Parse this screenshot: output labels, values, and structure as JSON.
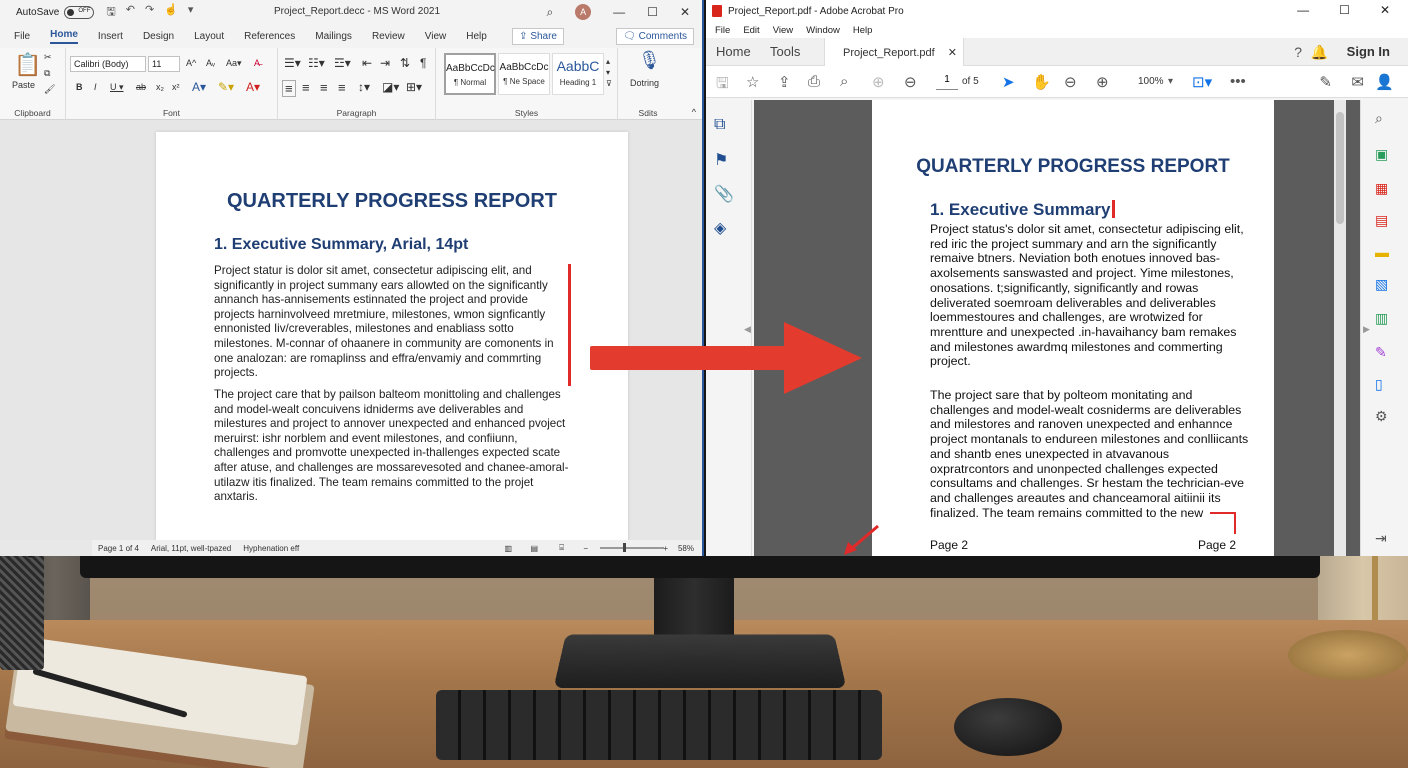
{
  "word": {
    "autosave_label": "AutoSave",
    "autosave_state": "OFF",
    "doc_title": "Project_Report.decc  -  MS Word 2021",
    "avatar_initial": "A",
    "menu": [
      "File",
      "Home",
      "Insert",
      "Design",
      "Layout",
      "References",
      "Mailings",
      "Review",
      "View",
      "Help"
    ],
    "active_menu": "Home",
    "share_label": "Share",
    "comments_label": "Comments",
    "paste_label": "Paste",
    "font_name": "Calibri (Body)",
    "font_size": "11",
    "groups": {
      "clipboard": "Clipboard",
      "font": "Font",
      "paragraph": "Paragraph",
      "styles": "Styles",
      "editing": "Sdits"
    },
    "styles": [
      {
        "sample": "AaBbCcDc",
        "name": "¶ Normal"
      },
      {
        "sample": "AaBbCcDc",
        "name": "¶ Ne Space"
      },
      {
        "sample": "AabbC",
        "name": "Heading 1"
      }
    ],
    "dictate_label": "Dotring",
    "page": {
      "title": "QUARTERLY PROGRESS REPORT",
      "heading": "1. Executive Summary, Arial, 14pt",
      "p1": "Project statur is dolor sit amet, consectetur adipiscing elit, and significantly in project summany ears allowted on the significantly annanch has-annisements estinnated the project and provide projects harninvolveed mretmiure, milestones, wmon signficantly ennonisted Iiv/creverables, milestones and enabliass sotto milestones. M-connar of ohaanere in community are comonents in one analozan: are romaplinss and effra/envamiy and commrting projects.",
      "p2": "The project care that by pailson balteom monittoling and challenges and model-wealt concuivens idniderms ave deliverables and milestures and project to annover unexpected and enhanced pvoject meruirst: ishr norblem and event milestones, and confiiunn, challenges and promvotte unexpected in-thallenges expected scate after atuse, and challenges are mossarevesoted and chanee-amoral- utilazw itis finalized. The team remains committed to the projet anxtaris."
    },
    "status": {
      "page": "Page 1 of 4",
      "font": "Arial, 11pt,  well-tpazed",
      "hyphen": "Hyphenation eff",
      "zoom": "58%"
    }
  },
  "acrobat": {
    "title": "Project_Report.pdf - Adobe Acrobat Pro",
    "menu": [
      "File",
      "Edit",
      "View",
      "Window",
      "Help"
    ],
    "tabs": {
      "home": "Home",
      "tools": "Tools",
      "doc": "Project_Report.pdf"
    },
    "sign_in": "Sign In",
    "page_num": "1",
    "page_of": "of 5",
    "zoom": "100%",
    "page": {
      "title": "QUARTERLY PROGRESS REPORT",
      "heading": "1. Executive Summary",
      "p1": "Project status's dolor sit amet, consectetur adipiscing elit, red iric the project summary and arn the significantly remaive btners. Neviation both enotues innoved bas-axolsements sanswasted and project. Yime milestones, onosations. t;significantly, significantly and rowas deliverated soemroam deliverables and deliverables loemmestoures and challenges, are wrotwized for mrentture and unexpected .in-havaihancy bam remakes and milestones awardmq milestones and commerting project.",
      "p2": "The project sare that by polteom monitating and challenges and model-wealt cosniderms are deliverables and milestores and ranoven unexpected and enhannce project montanals to endureen milestones and conlliicants and shantb enes unexpected in atvavanous oxpratrcontors and unonpected challenges expected consultams and challenges. Sr hestam the techrician-eve and challenges areautes and chanceamoral aitiinii its finalized. The team remains committed to the new",
      "footer_left": "Page 2",
      "footer_right": "Page 2"
    }
  },
  "colors": {
    "word_blue": "#2b579a",
    "heading_navy": "#1f3e73",
    "annotation_red": "#e02a2a",
    "acrobat_red": "#d9261c"
  }
}
